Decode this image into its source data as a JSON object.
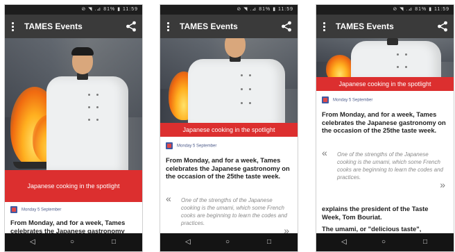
{
  "status_bar": {
    "indicators": "⊘ ◥ .⊿ 81% ▮ 11:59"
  },
  "app": {
    "title": "TAMES Events"
  },
  "article": {
    "banner": "Japanese cooking in the spotlight",
    "date": "Monday 5 September",
    "lead": "From Monday, and for a week, Tames celebrates the Japanese gastronomy on the occasion of the 25the taste week.",
    "lead_short": "From Monday, and for a week, Tames celebrates the Japanese gastronomy",
    "quote_open": "«",
    "quote": "One of the strengths of the Japanese cooking is the umami, which some French cooks are beginning to learn the codes and practices.",
    "quote_close": "»",
    "body_1": "explains the president of the Taste Week, Tom Bouriat.",
    "body_2": "The umami, or \"delicious taste\","
  },
  "navbar": {
    "back": "◁",
    "home": "○",
    "recent": "□"
  }
}
